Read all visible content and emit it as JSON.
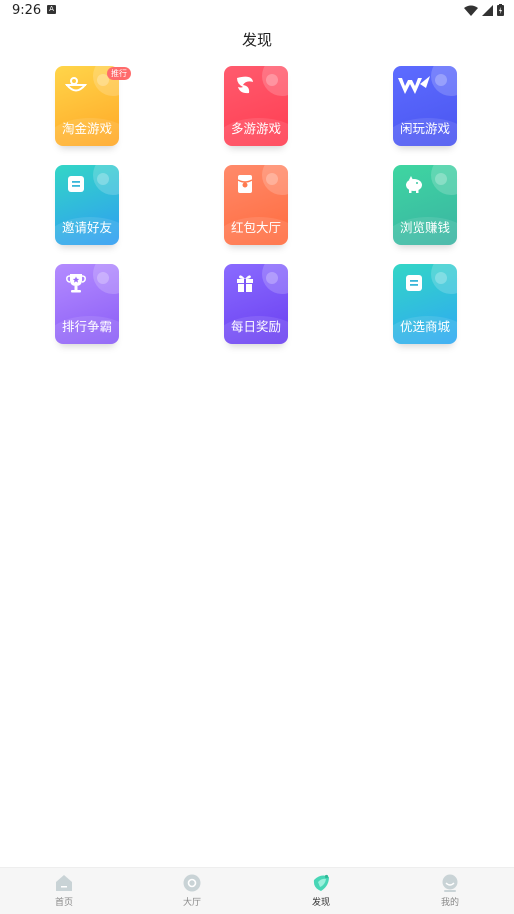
{
  "status_bar": {
    "time": "9:26",
    "a_badge": "A"
  },
  "header": {
    "title": "发现"
  },
  "tiles": [
    {
      "label": "淘金游戏",
      "badge": "推行",
      "icon": "bowl-icon",
      "colors": [
        "#ffd54a",
        "#ffa726"
      ]
    },
    {
      "label": "多游游戏",
      "icon": "swirl-logo-icon",
      "colors": [
        "#ff5b6e",
        "#ff3d51"
      ]
    },
    {
      "label": "闲玩游戏",
      "icon": "w-logo-icon",
      "colors": [
        "#5d6cff",
        "#4a55f0"
      ]
    },
    {
      "label": "邀请好友",
      "icon": "note-icon",
      "colors": [
        "#33d6c6",
        "#2f9cf3"
      ]
    },
    {
      "label": "红包大厅",
      "icon": "red-envelope-icon",
      "colors": [
        "#ff8a6b",
        "#ff6b3d"
      ]
    },
    {
      "label": "浏览赚钱",
      "icon": "piggy-bank-icon",
      "colors": [
        "#3ed6a1",
        "#3bb3a3"
      ]
    },
    {
      "label": "排行争霸",
      "icon": "trophy-icon",
      "colors": [
        "#b48cff",
        "#8a5cf6"
      ]
    },
    {
      "label": "每日奖励",
      "icon": "gift-icon",
      "colors": [
        "#8a6bff",
        "#6a3ff0"
      ]
    },
    {
      "label": "优选商城",
      "icon": "note-icon",
      "colors": [
        "#33d6c6",
        "#2fa8f3"
      ]
    }
  ],
  "bottom_nav": [
    {
      "label": "首页",
      "icon": "home-icon",
      "active": false
    },
    {
      "label": "大厅",
      "icon": "lobby-icon",
      "active": false
    },
    {
      "label": "发现",
      "icon": "discover-icon",
      "active": true
    },
    {
      "label": "我的",
      "icon": "profile-icon",
      "active": false
    }
  ],
  "colors": {
    "badge": "#ff6b6b",
    "nav_bg": "#f6f6f6",
    "nav_icon": "#c9d3d6"
  }
}
